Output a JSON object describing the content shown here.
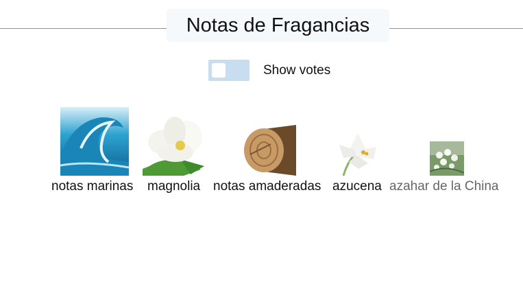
{
  "header": {
    "title": "Notas de Fragancias"
  },
  "controls": {
    "show_votes_label": "Show votes"
  },
  "notes": [
    {
      "label": "notas marinas",
      "icon": "wave-image"
    },
    {
      "label": "magnolia",
      "icon": "magnolia-flower-image"
    },
    {
      "label": "notas amaderadas",
      "icon": "wood-log-image"
    },
    {
      "label": "azucena",
      "icon": "lily-flower-image"
    },
    {
      "label": "azahar de la China",
      "icon": "orange-blossom-image"
    }
  ]
}
